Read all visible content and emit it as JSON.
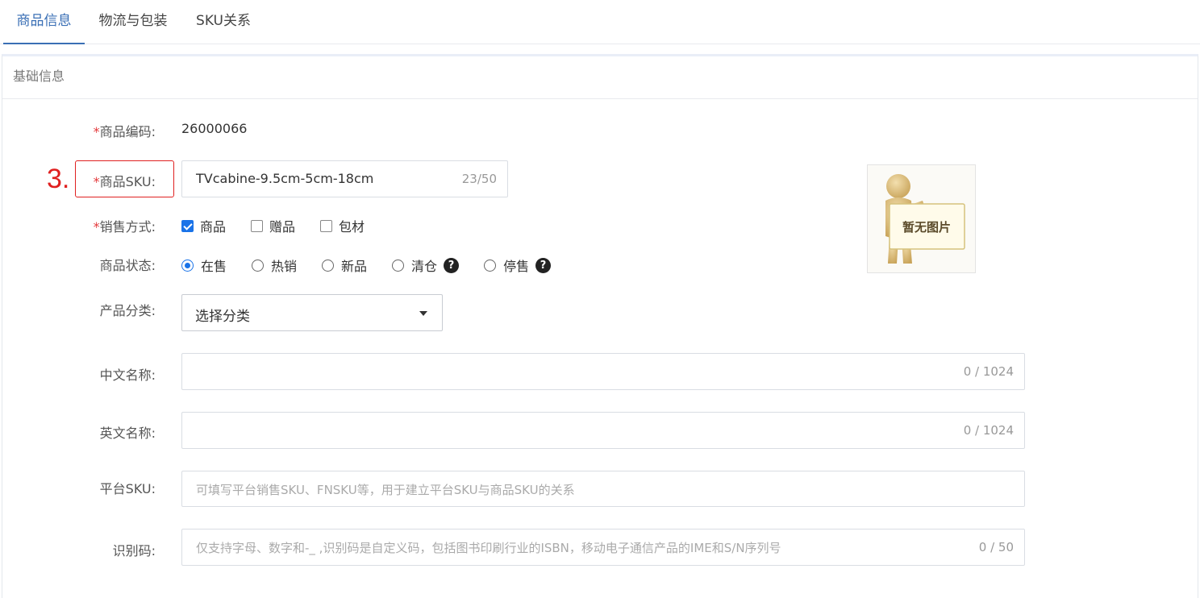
{
  "tabs": [
    {
      "label": "商品信息"
    },
    {
      "label": "物流与包装"
    },
    {
      "label": "SKU关系"
    }
  ],
  "panel": {
    "title": "基础信息"
  },
  "annotation": {
    "step": "3."
  },
  "form": {
    "required_mark": "*",
    "product_code": {
      "label": "商品编码:",
      "value": "26000066"
    },
    "product_sku": {
      "label": "商品SKU:",
      "value": "TVcabine-9.5cm-5cm-18cm",
      "counter": "23/50"
    },
    "sale_mode": {
      "label": "销售方式:",
      "options": [
        {
          "label": "商品",
          "checked": true
        },
        {
          "label": "赠品",
          "checked": false
        },
        {
          "label": "包材",
          "checked": false
        }
      ]
    },
    "product_status": {
      "label": "商品状态:",
      "options": [
        {
          "label": "在售",
          "checked": true
        },
        {
          "label": "热销",
          "checked": false
        },
        {
          "label": "新品",
          "checked": false
        },
        {
          "label": "清仓",
          "checked": false,
          "help": "?"
        },
        {
          "label": "停售",
          "checked": false,
          "help": "?"
        }
      ]
    },
    "category": {
      "label": "产品分类:",
      "value": "选择分类"
    },
    "cn_name": {
      "label": "中文名称:",
      "value": "",
      "counter": "0 / 1024"
    },
    "en_name": {
      "label": "英文名称:",
      "value": "",
      "counter": "0 / 1024"
    },
    "platform_sku": {
      "label": "平台SKU:",
      "placeholder": "可填写平台销售SKU、FNSKU等，用于建立平台SKU与商品SKU的关系"
    },
    "identifier": {
      "label": "识别码:",
      "placeholder": "仅支持字母、数字和-_ ,识别码是自定义码，包括图书印刷行业的ISBN，移动电子通信产品的IME和S/N序列号",
      "counter": "0 / 50"
    }
  },
  "image_placeholder": {
    "text": "暂无图片"
  },
  "colors": {
    "accent": "#3a6fb5",
    "required": "#e4393c",
    "annotation": "#e02020",
    "checkbox": "#1a73e8"
  }
}
